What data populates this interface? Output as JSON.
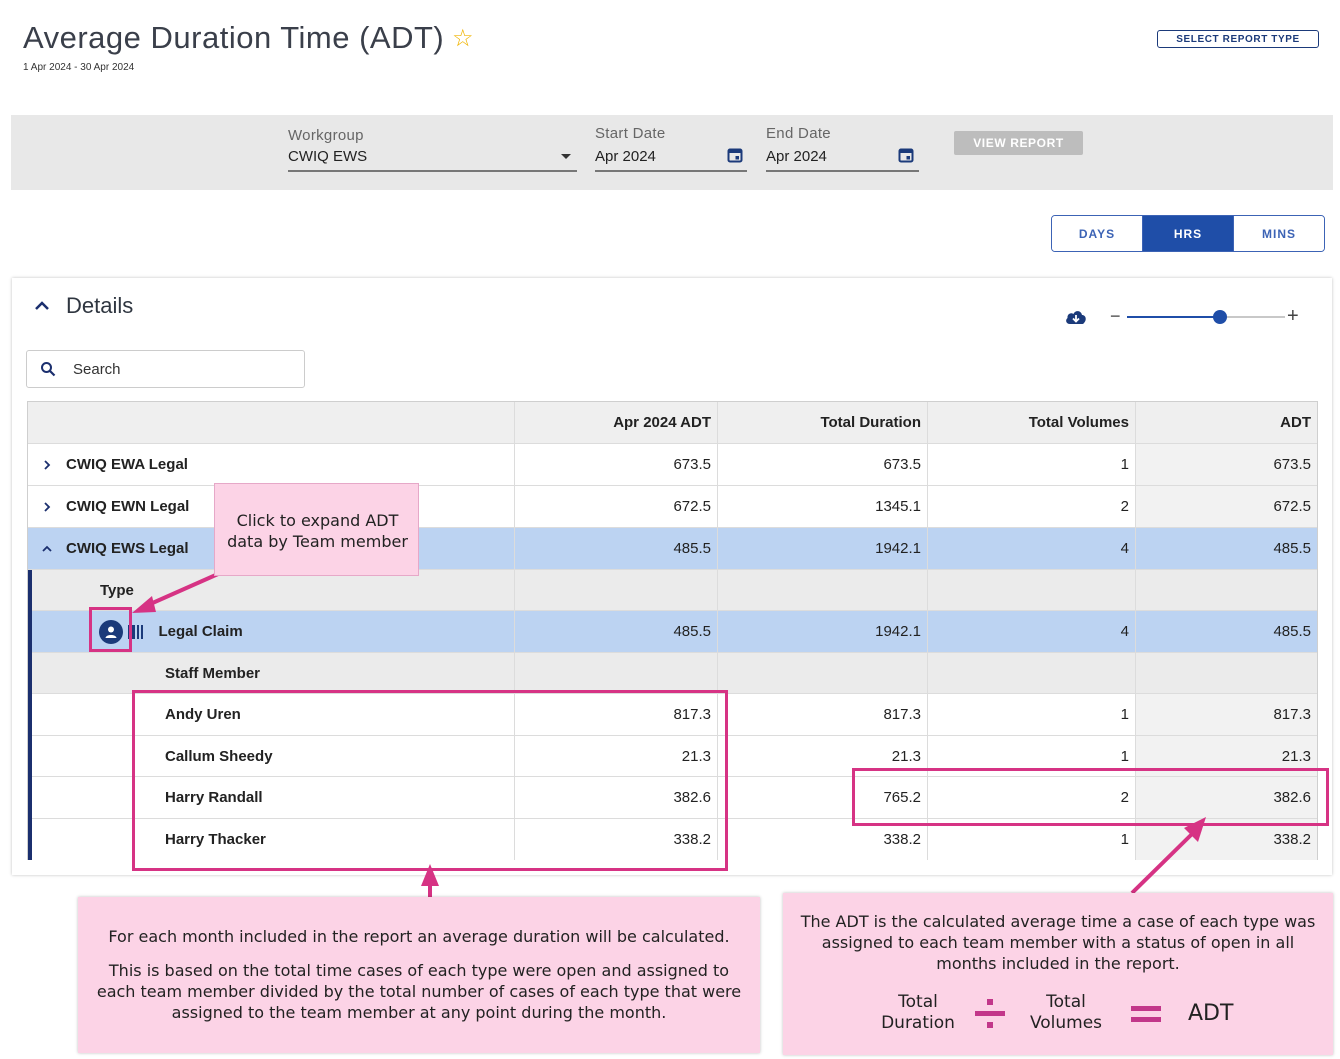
{
  "header": {
    "title": "Average Duration Time (ADT)",
    "date_range": "1 Apr 2024 - 30 Apr 2024",
    "select_report_label": "SELECT REPORT TYPE"
  },
  "filters": {
    "workgroup_label": "Workgroup",
    "workgroup_value": "CWIQ EWS",
    "start_label": "Start Date",
    "start_value": "Apr 2024",
    "end_label": "End Date",
    "end_value": "Apr 2024",
    "view_report_label": "VIEW REPORT"
  },
  "units": {
    "items": [
      "DAYS",
      "HRS",
      "MINS"
    ],
    "active": "HRS"
  },
  "details": {
    "title": "Details",
    "search_placeholder": "Search",
    "columns": [
      "",
      "Apr 2024 ADT",
      "Total Duration",
      "Total Volumes",
      "ADT"
    ],
    "rows": [
      {
        "label": "CWIQ EWA Legal",
        "values": [
          "673.5",
          "673.5",
          "1",
          "673.5"
        ]
      },
      {
        "label": "CWIQ EWN Legal",
        "values": [
          "672.5",
          "1345.1",
          "2",
          "672.5"
        ]
      },
      {
        "label": "CWIQ EWS Legal",
        "values": [
          "485.5",
          "1942.1",
          "4",
          "485.5"
        ]
      }
    ],
    "type_label": "Type",
    "type_row": {
      "label": "Legal Claim",
      "values": [
        "485.5",
        "1942.1",
        "4",
        "485.5"
      ]
    },
    "staff_label": "Staff Member",
    "staff": [
      {
        "label": "Andy Uren",
        "values": [
          "817.3",
          "817.3",
          "1",
          "817.3"
        ]
      },
      {
        "label": "Callum Sheedy",
        "values": [
          "21.3",
          "21.3",
          "1",
          "21.3"
        ]
      },
      {
        "label": "Harry Randall",
        "values": [
          "382.6",
          "765.2",
          "2",
          "382.6"
        ]
      },
      {
        "label": "Harry Thacker",
        "values": [
          "338.2",
          "338.2",
          "1",
          "338.2"
        ]
      }
    ]
  },
  "annotations": {
    "expand_tip": "Click to expand ADT data by Team member",
    "month_p1": "For each month included in the report an average duration will be calculated.",
    "month_p2": "This is based on the total time cases of each type were open and assigned to each team member divided by the total number of cases of each type that were assigned to the team member at any point during the month.",
    "adt_text": "The ADT is the calculated average time a case of each type was assigned to each team member with a status of open in all months included in the report.",
    "formula_total": "Total",
    "formula_duration": "Duration",
    "formula_volumes": "Volumes",
    "formula_result": "ADT"
  },
  "colors": {
    "accent": "#1f4ea8",
    "selected_row": "#bcd3f2",
    "callout_bg": "#fcd3e6",
    "callout_border": "#d63384",
    "star": "#f0b400"
  }
}
